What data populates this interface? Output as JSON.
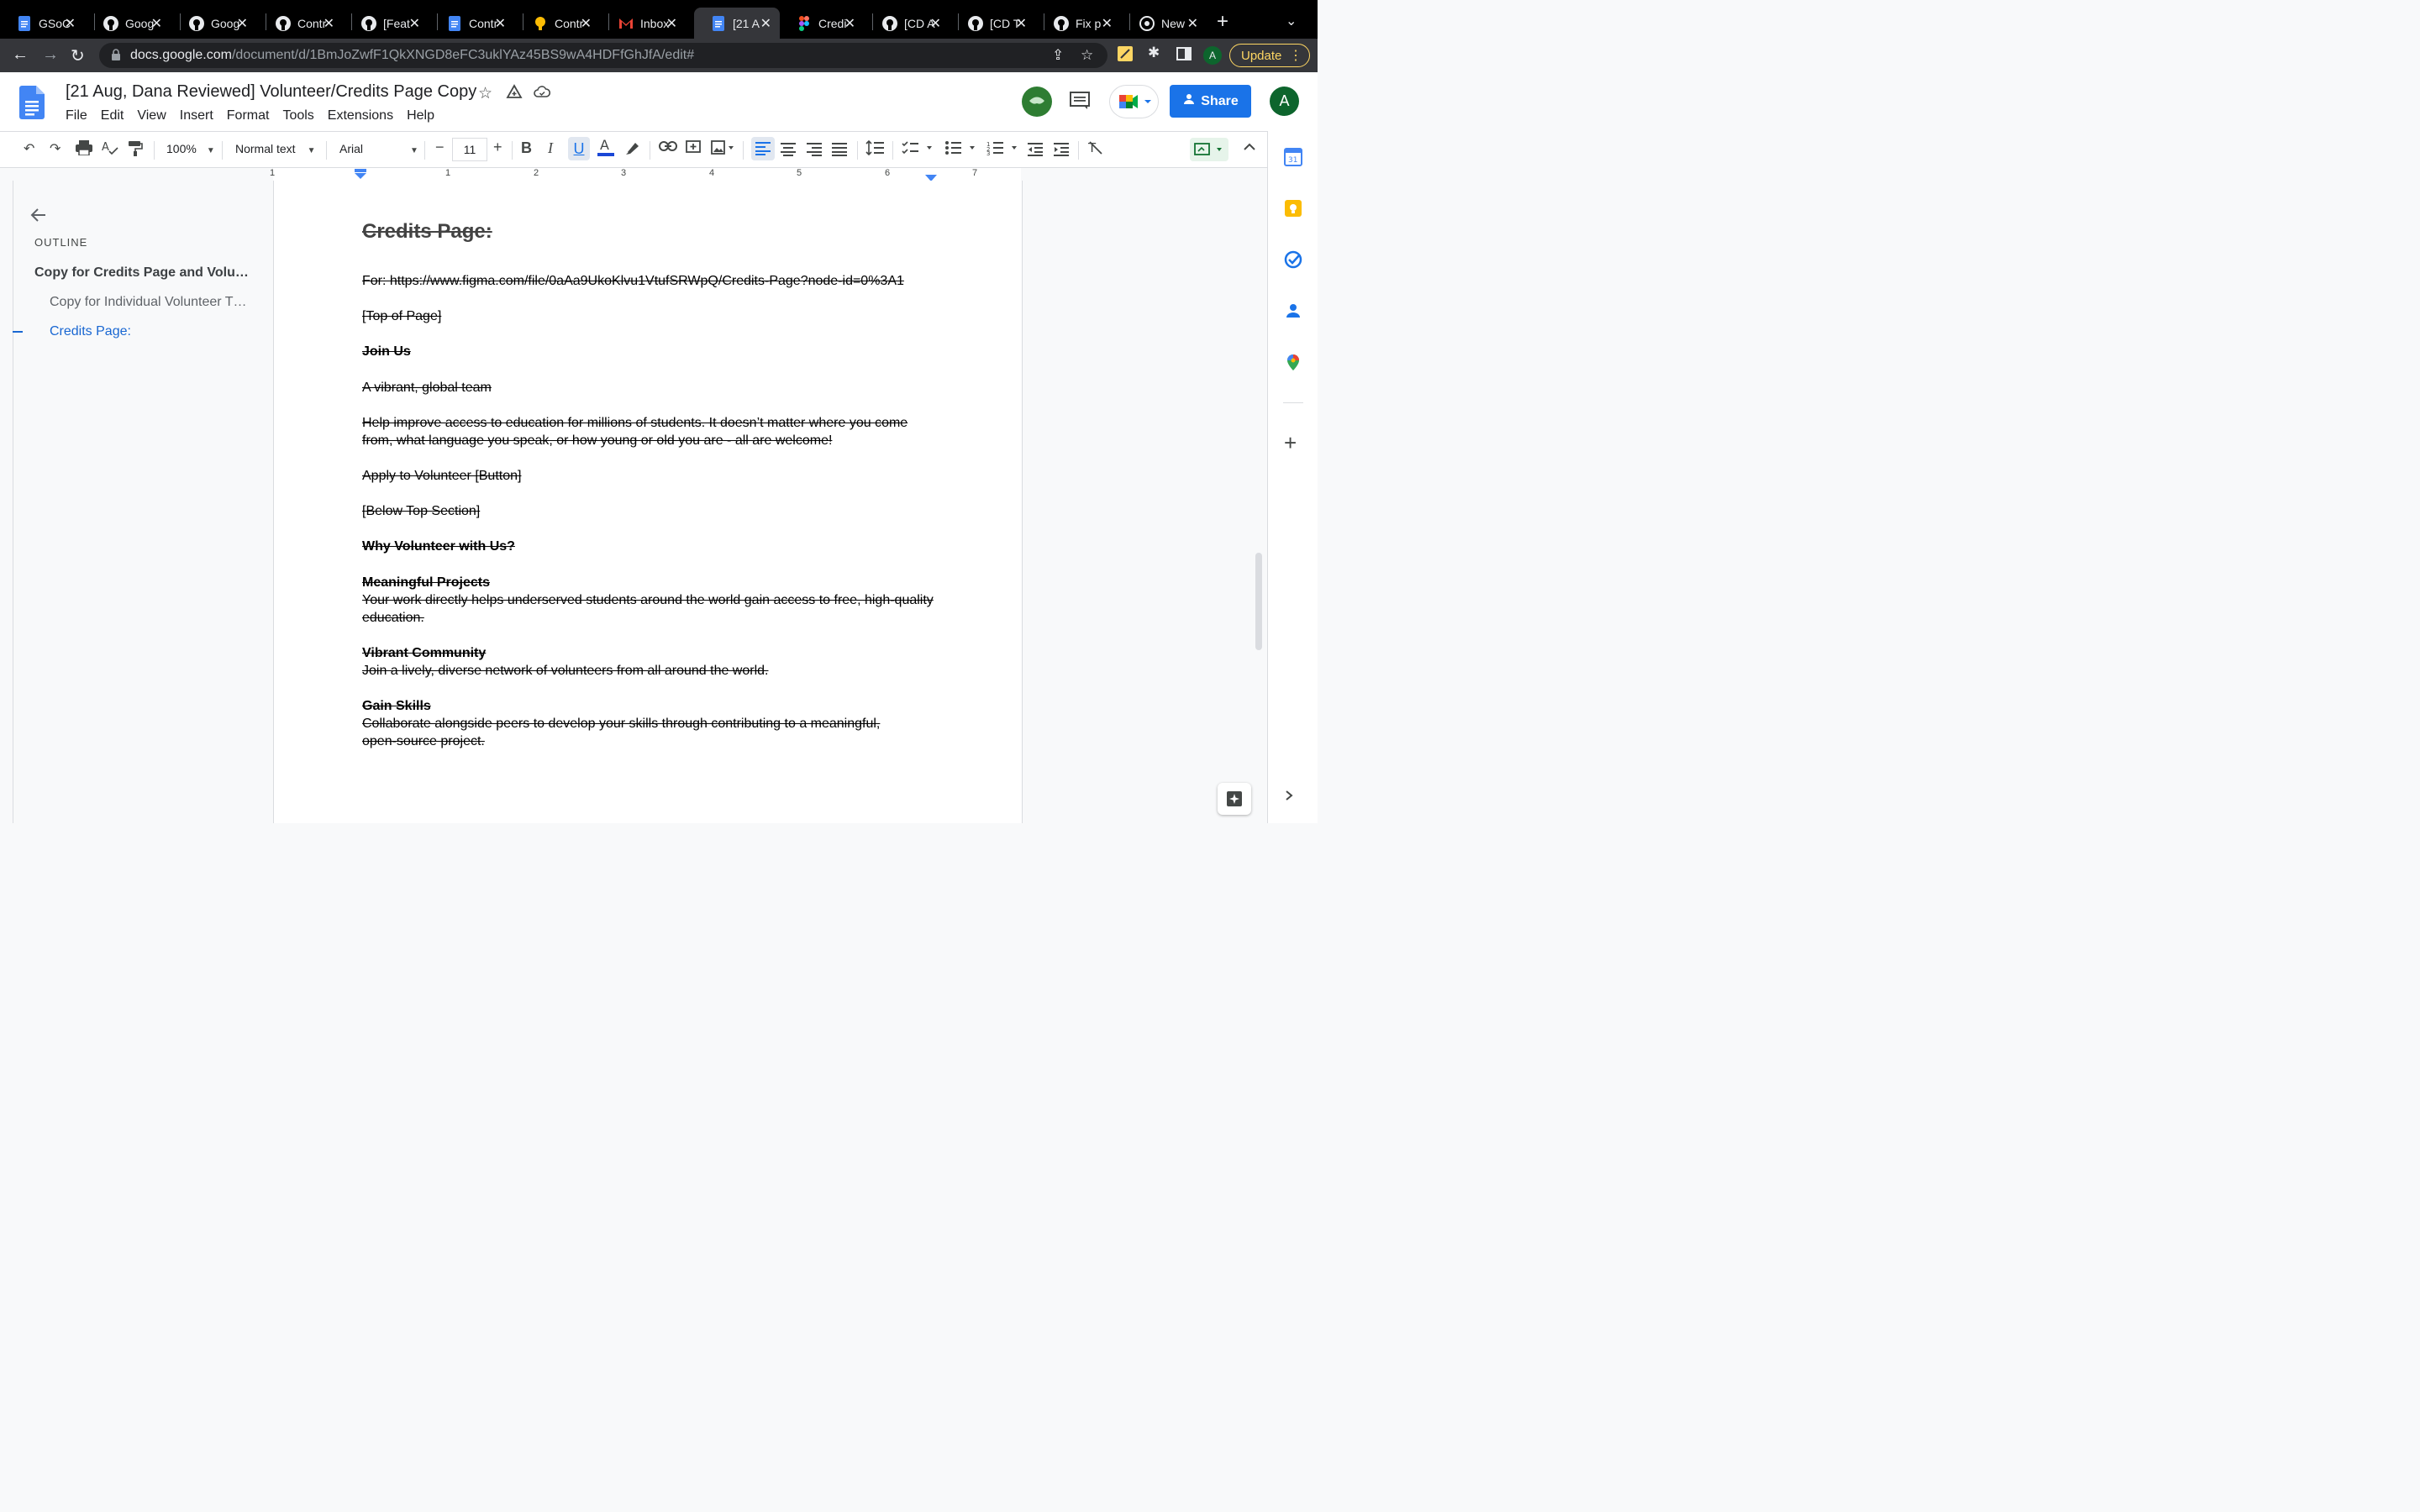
{
  "browser": {
    "tabs": [
      {
        "title": "GSoC",
        "icon": "google-docs-icon"
      },
      {
        "title": "Goog",
        "icon": "github-icon"
      },
      {
        "title": "Goog",
        "icon": "github-icon"
      },
      {
        "title": "Contr",
        "icon": "github-icon"
      },
      {
        "title": "[Feat",
        "icon": "github-icon"
      },
      {
        "title": "Contr",
        "icon": "google-docs-icon"
      },
      {
        "title": "Contr",
        "icon": "google-keep-icon"
      },
      {
        "title": "Inbox",
        "icon": "gmail-icon"
      },
      {
        "title": "[21 A",
        "icon": "google-docs-icon",
        "active": true
      },
      {
        "title": "Credi",
        "icon": "figma-icon"
      },
      {
        "title": "[CD A",
        "icon": "github-icon"
      },
      {
        "title": "[CD T",
        "icon": "github-icon"
      },
      {
        "title": "Fix p",
        "icon": "github-icon"
      },
      {
        "title": "New",
        "icon": "chrome-icon"
      }
    ],
    "url_host": "docs.google.com",
    "url_path": "/document/d/1BmJoZwfF1QkXNGD8eFC3uklYAz45BS9wA4HDFfGhJfA/edit#",
    "profile_initial": "A",
    "update_label": "Update"
  },
  "doc": {
    "title": "[21 Aug, Dana Reviewed] Volunteer/Credits Page Copy",
    "menu": [
      "File",
      "Edit",
      "View",
      "Insert",
      "Format",
      "Tools",
      "Extensions",
      "Help"
    ],
    "share_label": "Share",
    "account_initial": "A"
  },
  "toolbar": {
    "zoom": "100%",
    "style": "Normal text",
    "font": "Arial",
    "font_size": "11"
  },
  "ruler": [
    "1",
    "1",
    "2",
    "3",
    "4",
    "5",
    "6",
    "7"
  ],
  "outline": {
    "label": "OUTLINE",
    "items": [
      "Copy for Credits Page and Volu…",
      "Copy for Individual Volunteer T…",
      "Credits Page:"
    ]
  },
  "content": [
    "Credits Page:",
    "For: https://www.figma.com/file/0aAa9UkoKlvu1VtufSRWpQ/Credits-Page?node-id=0%3A1",
    "[Top of Page]",
    "Join Us",
    "A vibrant, global team",
    "Help improve access to education for millions of students. It doesn’t matter where you come",
    "from, what language you speak, or how young or old you are - all are welcome!",
    "Apply to Volunteer [Button]",
    "[Below Top Section]",
    "Why Volunteer with Us?",
    "Meaningful Projects",
    "Your work directly helps underserved students around the world gain access to free, high-quality",
    "education.",
    "Vibrant Community",
    "Join a lively, diverse network of volunteers from all around the world.",
    "Gain Skills",
    "Collaborate alongside peers to develop your skills through contributing to a meaningful,",
    "open-source project."
  ],
  "colors": {
    "accent": "#1a73e8",
    "outline_active": "#1967d2",
    "update": "#fdd663"
  }
}
